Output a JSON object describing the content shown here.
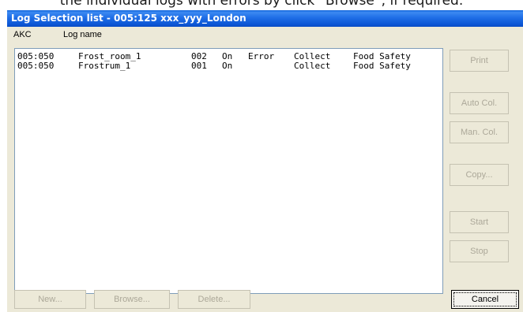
{
  "caption": "the individual logs with errors by click “Browse”, if required.",
  "window": {
    "title": "Log Selection list - 005:125  xxx_yyy_London"
  },
  "list": {
    "headers": [
      "AKC",
      "Log name"
    ],
    "rows": [
      [
        "005:050",
        "Frost_room_1",
        "002",
        "On",
        "Error",
        "Collect",
        "Food Safety"
      ],
      [
        "005:050",
        "Frostrum_1",
        "001",
        "On",
        "",
        "Collect",
        "Food Safety"
      ]
    ]
  },
  "buttons": {
    "print": "Print",
    "auto_col": "Auto Col.",
    "man_col": "Man. Col.",
    "copy": "Copy...",
    "start": "Start",
    "stop": "Stop",
    "new": "New...",
    "browse": "Browse...",
    "delete": "Delete...",
    "cancel": "Cancel"
  }
}
